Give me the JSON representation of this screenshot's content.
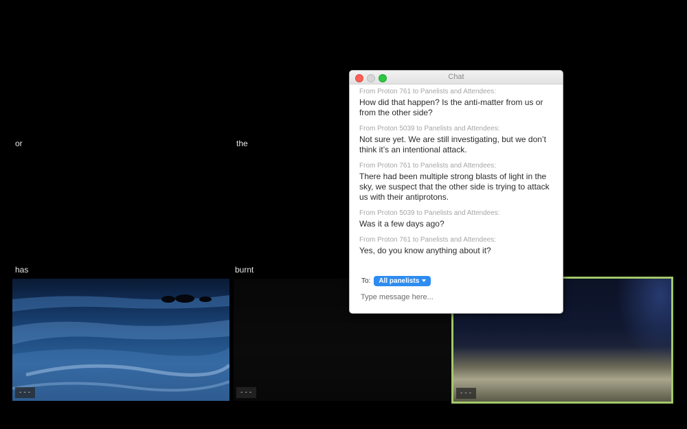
{
  "captions": {
    "or": "or",
    "the": "the",
    "has": "has",
    "burnt": "burnt"
  },
  "tiles": {
    "ocean_label": "---",
    "dark_label": "---",
    "active_label": "---",
    "active_border_color": "#a4c96a"
  },
  "chat": {
    "title": "Chat",
    "messages": [
      {
        "from": "From Proton 761 to Panelists and Attendees:",
        "text": "How did that happen? Is the anti-matter from us or from the other side?"
      },
      {
        "from": "From Proton 5039 to Panelists and Attendees:",
        "text": "Not sure yet. We are still investigating, but we don’t think it’s an intentional attack."
      },
      {
        "from": "From Proton 761 to Panelists and Attendees:",
        "text": "There had been multiple strong blasts of light in the sky, we suspect that the other side is trying to attack us with their antiprotons."
      },
      {
        "from": "From Proton 5039 to Panelists and Attendees:",
        "text": "Was it a few days ago?"
      },
      {
        "from": "From Proton 761 to Panelists and Attendees:",
        "text": "Yes, do you know anything about it?"
      }
    ],
    "to_label": "To:",
    "recipient": "All panelists",
    "recipient_color": "#2d8cf0",
    "input_placeholder": "Type message here..."
  }
}
